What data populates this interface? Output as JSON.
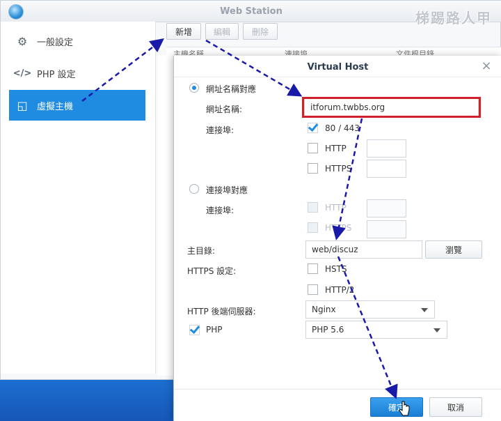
{
  "window": {
    "title": "Web Station",
    "watermark": "梯踢路人甲"
  },
  "sidebar": {
    "items": [
      {
        "label": "一般設定",
        "icon": "gear-icon",
        "glyph": "⚙"
      },
      {
        "label": "PHP 設定",
        "icon": "code-icon",
        "glyph": "</>"
      },
      {
        "label": "虛擬主機",
        "icon": "virtual-host-icon",
        "glyph": "◱"
      }
    ]
  },
  "toolbar": {
    "add": "新增",
    "edit": "編輯",
    "delete": "刪除"
  },
  "grid": {
    "columns": [
      "主機名稱",
      "連接埠",
      "文件根目錄"
    ]
  },
  "dialog": {
    "title": "Virtual Host",
    "close": "×",
    "radio_hostname": "網址名稱對應",
    "hostname_label": "網址名稱:",
    "hostname_value": "itforum.twbbs.org",
    "port_label": "連接埠:",
    "port_options": [
      "80 / 443",
      "HTTP",
      "HTTPS"
    ],
    "radio_port": "連接埠對應",
    "port2_label": "連接埠:",
    "port2_options": [
      "HTTP",
      "HTTPS"
    ],
    "docroot_label": "主目錄:",
    "docroot_value": "web/discuz",
    "browse": "瀏覽",
    "https_label": "HTTPS 設定:",
    "https_options": [
      "HSTS",
      "HTTP/2"
    ],
    "backend_label": "HTTP 後端伺服器:",
    "backend_value": "Nginx",
    "php_label": "PHP",
    "php_value": "PHP 5.6",
    "ok": "確定",
    "cancel": "取消"
  },
  "colors": {
    "accent": "#1f8ce2",
    "highlight": "#d0202b",
    "arrow": "#1a1aa8"
  }
}
